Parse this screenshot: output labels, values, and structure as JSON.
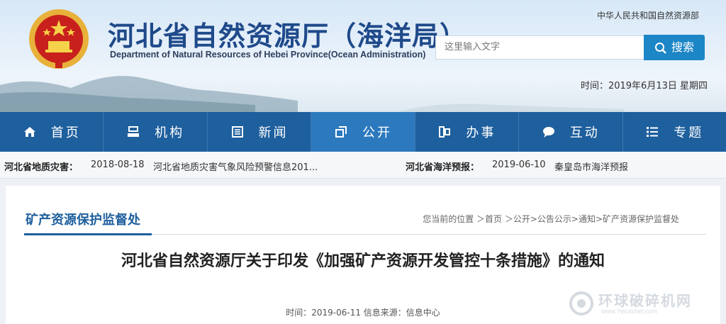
{
  "header": {
    "title_cn": "河北省自然资源厅（海洋局）",
    "title_en": "Department of Natural Resources of Hebei Province(Ocean Administration)",
    "ministry_link": "中华人民共和国自然资源部",
    "search_placeholder": "这里输入文字",
    "search_button": "搜索",
    "date_line": "时间：2019年6月13日 星期四"
  },
  "nav": {
    "items": [
      {
        "label": "首页",
        "icon": "home-icon"
      },
      {
        "label": "机构",
        "icon": "org-icon"
      },
      {
        "label": "新闻",
        "icon": "news-icon"
      },
      {
        "label": "公开",
        "icon": "open-icon"
      },
      {
        "label": "办事",
        "icon": "service-icon"
      },
      {
        "label": "互动",
        "icon": "chat-icon"
      },
      {
        "label": "专题",
        "icon": "list-icon"
      }
    ],
    "active_index": 3
  },
  "ticker": {
    "left_label": "河北省地质灾害：",
    "left_date": "2018-08-18",
    "left_text": "河北省地质灾害气象风险预警信息201...",
    "right_label": "河北省海洋预报：",
    "right_date": "2019-06-10",
    "right_text": "秦皇岛市海洋预报"
  },
  "main": {
    "section_title": "矿产资源保护监督处",
    "breadcrumb": "您当前的位置 ＞首页 ＞公开>公告公示>通知>矿产资源保护监督处",
    "article_title": "河北省自然资源厅关于印发《加强矿产资源开发管控十条措施》的通知",
    "meta": "时间：2019-06-11 信息来源：信息中心"
  },
  "watermark": {
    "cn": "环球破碎机网",
    "en": "www.Yeruisher.com"
  },
  "colors": {
    "nav_bg": "#1e5f9d",
    "nav_active": "#2c79bd",
    "title_blue": "#1f4a8a",
    "search_btn": "#1c86c6"
  }
}
